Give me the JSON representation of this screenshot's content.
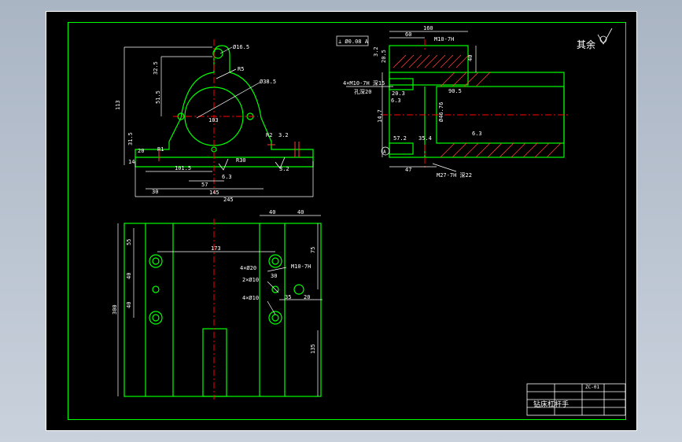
{
  "colors": {
    "background": "#000000",
    "frame": "#ffffff",
    "outline": "#00ff00",
    "dimension": "#ffffff",
    "centerline": "#ff0000",
    "hatch": "#ff3b3b",
    "viewport": "#b9c3d0"
  },
  "roughness_note": "其余",
  "front_view": {
    "labels": {
      "top_hole": "Ø16.5",
      "r_top": "R5",
      "bore": "Ø38.5",
      "center_width": "103",
      "height_total": "113",
      "dim_32_5": "32.5",
      "dim_51_5": "51.5",
      "dim_31_5": "31.5",
      "dim_20": "20",
      "dim_14": "14",
      "r1": "R1",
      "r2": "R2",
      "rough_1": "3.2",
      "rough_2": "3.2",
      "rough_3": "6.3",
      "r30": "R30",
      "dim_101_5": "101.5",
      "dim_57": "57",
      "dim_30": "30",
      "dim_145": "145",
      "dim_245": "245"
    }
  },
  "side_view": {
    "labels": {
      "tolerance_frame": "⊥ Ø0.08 A",
      "dim_160": "160",
      "dim_60": "60",
      "thread_top": "M10-7H",
      "dim_3_2": "3.2",
      "dim_20_5": "20.5",
      "dim_40": "40",
      "thread_left": "4×M10-7H 深15",
      "depth_20": "孔深20",
      "dim_20_3": "20.3",
      "dim_6_3": "6.3",
      "dim_14_7": "14.7",
      "bore_dia": "Ø46.76",
      "dim_90_5": "90.5",
      "dim_57_2": "57.2",
      "dim_35_4": "35.4",
      "dim_47": "47",
      "thread_bottom": "M27-7H 深22",
      "rough_bottom": "6.3",
      "datum": "A"
    }
  },
  "plan_view": {
    "labels": {
      "dim_40a": "40",
      "dim_40b": "40",
      "dim_55": "55",
      "dim_75": "75",
      "dim_173": "173",
      "hole_1": "4×Ø20",
      "hole_2": "2×Ø10",
      "hole_3": "4×Ø10",
      "thread": "M10-7H",
      "dim_30": "30",
      "dim_40c": "40",
      "dim_40d": "40",
      "dim_35": "35",
      "dim_20": "20",
      "dim_300": "300",
      "dim_135": "135"
    }
  },
  "title_block": {
    "title": "钻床杠杆手",
    "drawing_no": "ZC-01"
  }
}
